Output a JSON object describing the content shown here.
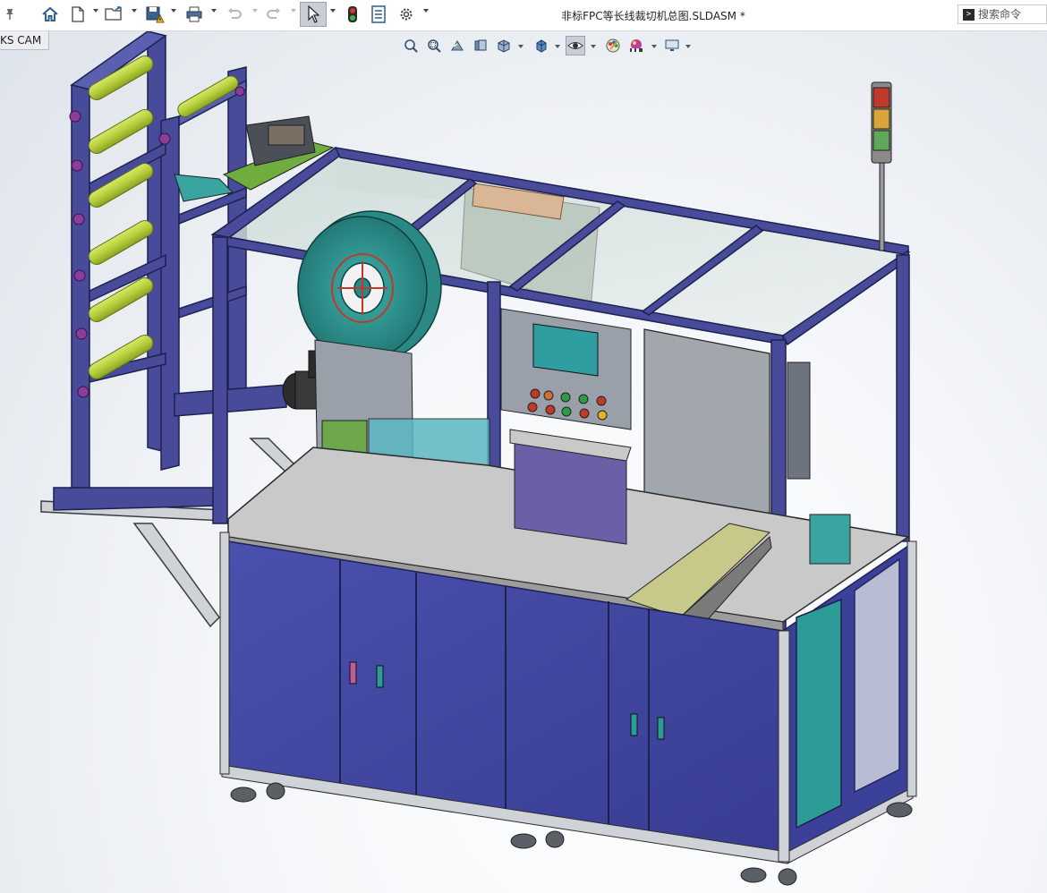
{
  "window": {
    "title": "非标FPC等长线裁切机总图.SLDASM *"
  },
  "toolbar": {
    "buttons": [
      {
        "id": "home",
        "icon": "home-icon"
      },
      {
        "id": "new",
        "icon": "new-document-icon"
      },
      {
        "id": "open",
        "icon": "open-folder-icon"
      },
      {
        "id": "save",
        "icon": "save-warning-icon"
      },
      {
        "id": "print",
        "icon": "print-icon"
      },
      {
        "id": "undo",
        "icon": "undo-icon"
      },
      {
        "id": "redo",
        "icon": "redo-icon"
      },
      {
        "id": "select",
        "icon": "select-arrow-icon",
        "active": true
      },
      {
        "id": "rebuild",
        "icon": "traffic-light-icon"
      },
      {
        "id": "file-properties",
        "icon": "file-properties-icon"
      },
      {
        "id": "options",
        "icon": "gear-icon"
      }
    ]
  },
  "search": {
    "placeholder": "搜索命令"
  },
  "side_tab": {
    "label": "KS CAM"
  },
  "heads_up_toolbar": {
    "buttons": [
      {
        "id": "zoom-to-fit",
        "icon": "zoom-to-fit-icon"
      },
      {
        "id": "zoom-to-area",
        "icon": "zoom-to-area-icon"
      },
      {
        "id": "previous-view",
        "icon": "previous-view-icon"
      },
      {
        "id": "section-view",
        "icon": "section-view-icon"
      },
      {
        "id": "view-orientation",
        "icon": "view-orientation-icon"
      },
      {
        "id": "display-style",
        "icon": "display-style-icon"
      },
      {
        "id": "hide-show-items",
        "icon": "eye-icon",
        "active": true
      },
      {
        "id": "edit-appearance",
        "icon": "appearance-icon"
      },
      {
        "id": "apply-scene",
        "icon": "scene-icon"
      },
      {
        "id": "view-settings",
        "icon": "monitor-icon"
      }
    ]
  },
  "colors": {
    "frame": "#474b9a",
    "frame_edge": "#1e2150",
    "cabinet": "#3f45a0",
    "table_top": "#c9c9c9",
    "roller": "#b8cf3e",
    "green_part": "#5fbf3a",
    "teal_reel": "#2f9a96",
    "glass": "#b9d4d0"
  }
}
